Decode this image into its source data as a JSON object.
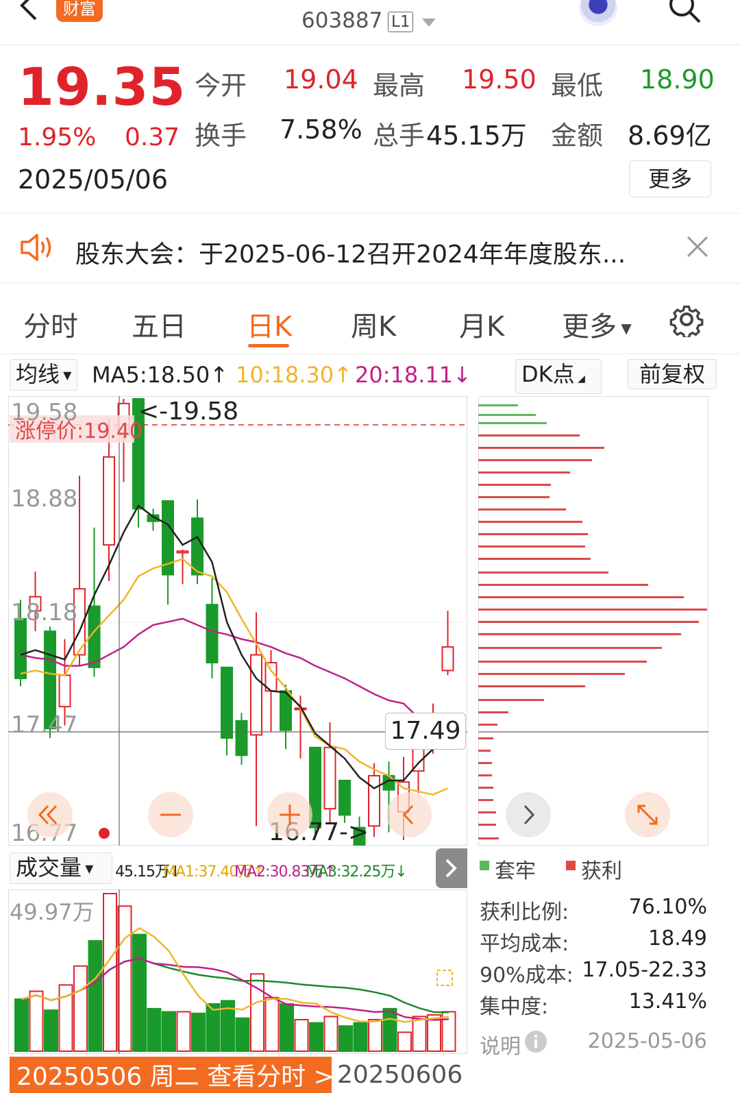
{
  "header": {
    "badge": "财富",
    "code": "603887",
    "level": "L1"
  },
  "quote": {
    "price": "19.35",
    "change_pct": "1.95%",
    "change": "0.37",
    "date": "2025/05/06",
    "open_label": "今开",
    "open": "19.04",
    "high_label": "最高",
    "high": "19.50",
    "low_label": "最低",
    "low": "18.90",
    "turnover_label": "换手",
    "turnover": "7.58%",
    "volume_label": "总手",
    "volume": "45.15万",
    "amount_label": "金额",
    "amount": "8.69亿",
    "more_label": "更多"
  },
  "announcement": {
    "text": "股东大会：于2025-06-12召开2024年年度股东..."
  },
  "tabs": [
    {
      "label": "分时"
    },
    {
      "label": "五日"
    },
    {
      "label": "日K"
    },
    {
      "label": "周K"
    },
    {
      "label": "月K"
    },
    {
      "label": "更多"
    }
  ],
  "ma_bar": {
    "select": "均线",
    "ma5": "MA5:18.50↑",
    "ma10": "10:18.30↑",
    "ma20": "20:18.11↓",
    "dk": "DK点",
    "adjust": "前复权"
  },
  "kline": {
    "axis": [
      "19.58",
      "18.88",
      "18.18",
      "17.47",
      "16.77"
    ],
    "limit_up": "涨停价:19.40",
    "high_marker": "<-19.58",
    "low_marker": "16.77->",
    "crosshair_price": "17.49"
  },
  "volume": {
    "select": "成交量",
    "vol": "45.15万↓",
    "ma1": "MA1:37.40万↑",
    "ma2": "MA2:30.83万↑",
    "ma3": "MA3:32.25万↓",
    "axis_top": "49.97万"
  },
  "chips": {
    "legend_trapped": "套牢",
    "legend_profit": "获利",
    "rows": [
      {
        "label": "获利比例:",
        "value": "76.10%"
      },
      {
        "label": "平均成本:",
        "value": "18.49"
      },
      {
        "label": "90%成本:",
        "value": "17.05-22.33"
      },
      {
        "label": "集中度:",
        "value": "13.41%"
      }
    ],
    "note_label": "说明",
    "note_date": "2025-05-06"
  },
  "bottom": {
    "bar": "20250506 周二 查看分时 >",
    "date": "20250606"
  },
  "colors": {
    "up": "#e0232a",
    "down": "#1a9a2a",
    "accent": "#f36b21",
    "ma5": "#222222",
    "ma10": "#f0b429",
    "ma20": "#c0208a"
  },
  "chart_data": {
    "type": "candlestick",
    "candles": [
      {
        "o": 18.18,
        "c": 17.8,
        "h": 18.3,
        "l": 17.75
      },
      {
        "o": 18.23,
        "c": 18.32,
        "h": 18.48,
        "l": 18.1
      },
      {
        "o": 18.1,
        "c": 17.48,
        "h": 18.13,
        "l": 17.42
      },
      {
        "o": 17.62,
        "c": 17.82,
        "h": 18.05,
        "l": 17.5
      },
      {
        "o": 17.95,
        "c": 18.37,
        "h": 19.09,
        "l": 17.88
      },
      {
        "o": 18.26,
        "c": 17.87,
        "h": 18.76,
        "l": 17.81
      },
      {
        "o": 18.65,
        "c": 19.21,
        "h": 19.45,
        "l": 18.42
      },
      {
        "o": 19.35,
        "c": 19.55,
        "h": 19.58,
        "l": 19.05
      },
      {
        "o": 19.58,
        "c": 18.88,
        "h": 19.58,
        "l": 18.76
      },
      {
        "o": 18.84,
        "c": 18.8,
        "h": 18.88,
        "l": 18.74
      },
      {
        "o": 18.93,
        "c": 18.46,
        "h": 18.93,
        "l": 18.27
      },
      {
        "o": 18.6,
        "c": 18.61,
        "h": 18.62,
        "l": 18.4
      },
      {
        "o": 18.82,
        "c": 18.46,
        "h": 18.94,
        "l": 18.4
      },
      {
        "o": 18.27,
        "c": 17.9,
        "h": 18.44,
        "l": 17.8
      },
      {
        "o": 17.87,
        "c": 17.42,
        "h": 17.87,
        "l": 17.31
      },
      {
        "o": 17.53,
        "c": 17.31,
        "h": 17.58,
        "l": 17.25
      },
      {
        "o": 17.44,
        "c": 17.95,
        "h": 18.22,
        "l": 16.86
      },
      {
        "o": 17.72,
        "c": 17.9,
        "h": 17.98,
        "l": 17.46
      },
      {
        "o": 17.72,
        "c": 17.47,
        "h": 17.76,
        "l": 17.35
      },
      {
        "o": 17.61,
        "c": 17.61,
        "h": 17.69,
        "l": 17.29
      },
      {
        "o": 17.36,
        "c": 16.85,
        "h": 17.36,
        "l": 16.79
      },
      {
        "o": 16.97,
        "c": 17.36,
        "h": 17.52,
        "l": 16.88
      },
      {
        "o": 17.15,
        "c": 16.93,
        "h": 17.15,
        "l": 16.88
      },
      {
        "o": 16.85,
        "c": 16.68,
        "h": 16.92,
        "l": 16.7
      },
      {
        "o": 16.86,
        "c": 17.18,
        "h": 17.26,
        "l": 16.79
      },
      {
        "o": 17.18,
        "c": 17.09,
        "h": 17.27,
        "l": 16.82
      },
      {
        "o": 16.95,
        "c": 17.14,
        "h": 17.3,
        "l": 16.77
      },
      {
        "o": 17.21,
        "c": 17.45,
        "h": 17.52,
        "l": 17.07
      },
      {
        "o": 17.37,
        "c": 17.56,
        "h": 17.64,
        "l": 17.32
      },
      {
        "o": 17.85,
        "c": 18.0,
        "h": 18.23,
        "l": 17.82
      }
    ],
    "ma5": [
      17.95,
      17.98,
      17.95,
      17.92,
      18.1,
      18.33,
      18.52,
      18.73,
      18.9,
      18.83,
      18.78,
      18.65,
      18.7,
      18.54,
      18.16,
      17.95,
      17.8,
      17.72,
      17.71,
      17.62,
      17.45,
      17.37,
      17.29,
      17.17,
      17.1,
      17.15,
      17.15,
      17.26,
      17.35,
      17.52
    ],
    "ma10": [
      17.83,
      17.85,
      17.83,
      17.82,
      17.98,
      18.1,
      18.2,
      18.3,
      18.45,
      18.5,
      18.53,
      18.56,
      18.48,
      18.45,
      18.35,
      18.18,
      18.02,
      17.85,
      17.74,
      17.61,
      17.43,
      17.37,
      17.35,
      17.27,
      17.22,
      17.18,
      17.1,
      17.08,
      17.06,
      17.1
    ],
    "ma20": [
      17.95,
      17.93,
      17.92,
      17.88,
      17.88,
      17.9,
      17.95,
      18.0,
      18.08,
      18.14,
      18.16,
      18.18,
      18.14,
      18.1,
      18.08,
      18.05,
      18.03,
      18.0,
      17.96,
      17.93,
      17.88,
      17.84,
      17.8,
      17.75,
      17.7,
      17.66,
      17.64,
      17.55,
      17.44,
      17.36
    ],
    "volume": [
      16.5,
      19.0,
      13.0,
      21.0,
      27.0,
      35.0,
      49.97,
      46.0,
      37.0,
      13.5,
      12.5,
      12.5,
      12.0,
      15.0,
      16.0,
      10.5,
      24.5,
      17.0,
      15.0,
      10.0,
      9.0,
      11.0,
      8.0,
      9.0,
      10.0,
      13.5,
      6.0,
      11.0,
      11.5,
      12.5
    ],
    "ylim": [
      16.77,
      19.58
    ],
    "vol_max": 49.97
  }
}
